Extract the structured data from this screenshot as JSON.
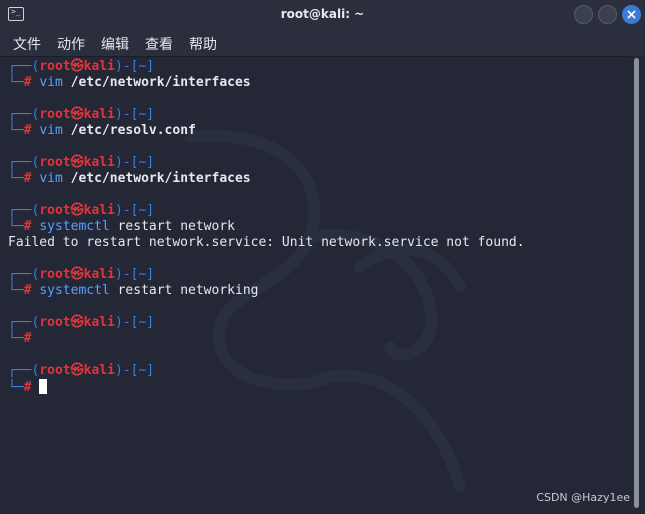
{
  "window": {
    "title": "root@kali: ~",
    "icon": "terminal-icon"
  },
  "menu": [
    "文件",
    "动作",
    "编辑",
    "查看",
    "帮助"
  ],
  "prompt": {
    "open": "┌──(",
    "user": "root",
    "at": "㉿",
    "host": "kali",
    "mid": ")-[",
    "dir": "~",
    "close": "]",
    "bottom": "└─",
    "hash": "#"
  },
  "blocks": [
    {
      "cmd": "vim",
      "args": "/etc/network/interfaces",
      "args_bold": true,
      "output": []
    },
    {
      "cmd": "vim",
      "args": "/etc/resolv.conf",
      "args_bold": true,
      "output": []
    },
    {
      "cmd": "vim",
      "args": "/etc/network/interfaces",
      "args_bold": true,
      "output": []
    },
    {
      "cmd": "systemctl",
      "args": "restart network",
      "args_bold": false,
      "output": [
        "Failed to restart network.service: Unit network.service not found."
      ]
    },
    {
      "cmd": "systemctl",
      "args": "restart networking",
      "args_bold": false,
      "output": []
    },
    {
      "cmd": "",
      "args": "",
      "args_bold": false,
      "output": []
    },
    {
      "cmd": "",
      "args": "",
      "args_bold": false,
      "output": [],
      "cursor": true
    }
  ],
  "watermark": "CSDN @Hazy1ee",
  "colors": {
    "prompt_frame": "#3b7fe0",
    "prompt_user": "#e0363b",
    "command": "#5aa0ff",
    "background": "#232736"
  }
}
